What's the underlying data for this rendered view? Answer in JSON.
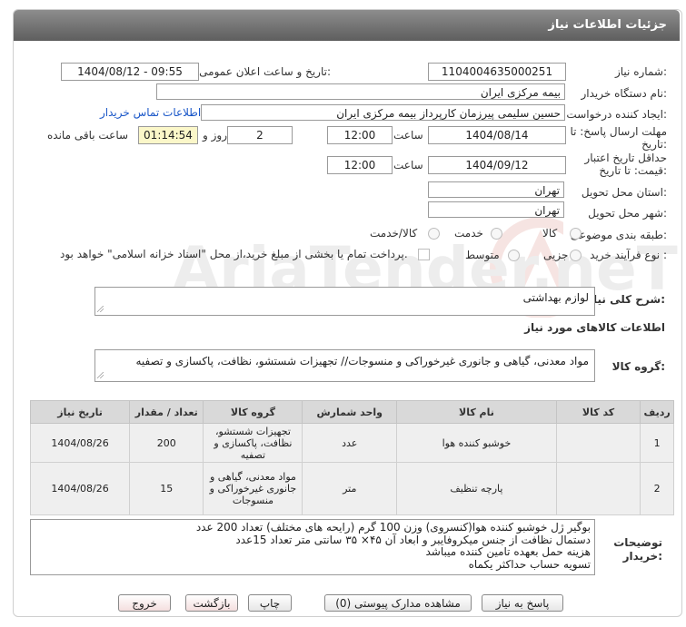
{
  "header": {
    "title": "جزئیات اطلاعات نیاز"
  },
  "fields": {
    "need_number_label": "شماره نیاز:",
    "need_number": "1104004635000251",
    "announce_label": "تاریخ و ساعت اعلان عمومی:",
    "announce_value": "1404/08/12 - 09:55",
    "buyer_org_label": "نام دستگاه خریدار:",
    "buyer_org": "بیمه مرکزی ایران",
    "creator_label": "ایجاد کننده درخواست:",
    "creator": "حسین سلیمی پیرزمان کارپرداز بیمه مرکزی ایران",
    "contact_link": "اطلاعات تماس خریدار",
    "deadline_label_1": "مهلت ارسال پاسخ: تا",
    "deadline_label_2": "تاریخ:",
    "deadline_date": "1404/08/14",
    "time_label": "ساعت",
    "deadline_time": "12:00",
    "days_value": "2",
    "days_label": "روز و",
    "remaining_time": "01:14:54",
    "remaining_label": "ساعت باقی مانده",
    "validity_label_1": "حداقل تاریخ اعتبار",
    "validity_label_2": "قیمت: تا تاریخ:",
    "validity_date": "1404/09/12",
    "validity_time": "12:00",
    "province_label": "استان محل تحویل:",
    "province": "تهران",
    "city_label": "شهر محل تحویل:",
    "city": "تهران",
    "category_label": "طبقه بندی موضوعی:",
    "category_options": [
      "کالا",
      "خدمت",
      "کالا/خدمت"
    ],
    "process_label": "نوع فرآیند خرید :",
    "process_options": [
      "جزیی",
      "متوسط"
    ],
    "payment_note": "پرداخت تمام یا بخشی از مبلغ خرید،از محل \"اسناد خزانه اسلامی\" خواهد بود."
  },
  "description": {
    "label": "شرح کلی نیاز:",
    "value": "لوازم بهداشتی"
  },
  "goods_info": {
    "title": "اطلاعات کالاهای مورد نیاز",
    "group_label": "گروه کالا:",
    "group_value": "مواد معدنی، گیاهی و جانوری غیرخوراکی و منسوجات// تجهیزات شستشو، نظافت، پاکسازی و تصفیه"
  },
  "table": {
    "headers": [
      "ردیف",
      "کد کالا",
      "نام کالا",
      "واحد شمارش",
      "گروه کالا",
      "تعداد / مقدار",
      "تاریخ نیاز"
    ],
    "rows": [
      {
        "index": "1",
        "code": "",
        "name": "خوشبو کننده هوا",
        "unit": "عدد",
        "group": "تجهیزات شستشو، نظافت، پاکسازی و تصفیه",
        "qty": "200",
        "date": "1404/08/26"
      },
      {
        "index": "2",
        "code": "",
        "name": "پارچه تنظیف",
        "unit": "متر",
        "group": "مواد معدنی، گیاهی و جانوری غیرخوراکی و منسوجات",
        "qty": "15",
        "date": "1404/08/26"
      }
    ]
  },
  "buyer_notes": {
    "label_1": "توضیحات",
    "label_2": "خریدار:",
    "lines": [
      "بوگیر ژل خوشبو کننده هوا(کنسروی)  وزن 100 گرم (رایحه های مختلف) تعداد 200 عدد",
      "دستمال نظافت  از جنس میکروفایبر  و ابعاد آن ۴۵× ۳۵ سانتی متر تعداد 15عدد",
      "هزینه حمل بعهده تامین کننده میباشد",
      "تسویه حساب حداکثر یکماه"
    ]
  },
  "buttons": {
    "reply": "پاسخ به نیاز",
    "attachments": "مشاهده مدارک پیوستی (0)",
    "print": "چاپ",
    "back": "بازگشت",
    "exit": "خروج"
  },
  "watermark_text": "AriaTender.neT"
}
